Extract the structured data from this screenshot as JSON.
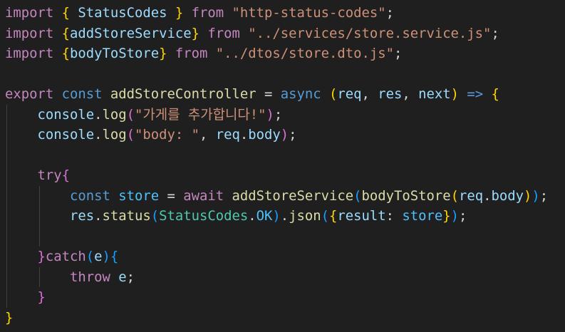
{
  "editor": {
    "theme_colors": {
      "background": "#1f1f1f",
      "keyword_control": "#c586c0",
      "keyword_storage": "#569cd6",
      "function": "#dcdcaa",
      "variable": "#9cdcfe",
      "constant": "#4fc1ff",
      "type": "#4ec9b0",
      "string": "#ce9178",
      "bracket_level1": "#ffd700",
      "bracket_level2": "#da70d6",
      "bracket_level3": "#179fff"
    },
    "lines": [
      [
        {
          "t": "import",
          "c": "kw"
        },
        {
          "t": " ",
          "c": "p"
        },
        {
          "t": "{",
          "c": "b1"
        },
        {
          "t": " StatusCodes ",
          "c": "vr"
        },
        {
          "t": "}",
          "c": "b1"
        },
        {
          "t": " from ",
          "c": "kw"
        },
        {
          "t": "\"http-status-codes\"",
          "c": "s"
        },
        {
          "t": ";",
          "c": "p"
        }
      ],
      [
        {
          "t": "import",
          "c": "kw"
        },
        {
          "t": " ",
          "c": "p"
        },
        {
          "t": "{",
          "c": "b1"
        },
        {
          "t": "addStoreService",
          "c": "vr"
        },
        {
          "t": "}",
          "c": "b1"
        },
        {
          "t": " from ",
          "c": "kw"
        },
        {
          "t": "\"../services/store.service.js\"",
          "c": "s"
        },
        {
          "t": ";",
          "c": "p"
        }
      ],
      [
        {
          "t": "import",
          "c": "kw"
        },
        {
          "t": " ",
          "c": "p"
        },
        {
          "t": "{",
          "c": "b1"
        },
        {
          "t": "bodyToStore",
          "c": "vr"
        },
        {
          "t": "}",
          "c": "b1"
        },
        {
          "t": " from ",
          "c": "kw"
        },
        {
          "t": "\"../dtos/store.dto.js\"",
          "c": "s"
        },
        {
          "t": ";",
          "c": "p"
        }
      ],
      [],
      [
        {
          "t": "export",
          "c": "kw"
        },
        {
          "t": " ",
          "c": "p"
        },
        {
          "t": "const",
          "c": "st"
        },
        {
          "t": " ",
          "c": "p"
        },
        {
          "t": "addStoreController",
          "c": "fn"
        },
        {
          "t": " = ",
          "c": "p"
        },
        {
          "t": "async",
          "c": "st"
        },
        {
          "t": " ",
          "c": "p"
        },
        {
          "t": "(",
          "c": "b1"
        },
        {
          "t": "req",
          "c": "vr"
        },
        {
          "t": ", ",
          "c": "p"
        },
        {
          "t": "res",
          "c": "vr"
        },
        {
          "t": ", ",
          "c": "p"
        },
        {
          "t": "next",
          "c": "vr"
        },
        {
          "t": ")",
          "c": "b1"
        },
        {
          "t": " ",
          "c": "p"
        },
        {
          "t": "=>",
          "c": "st"
        },
        {
          "t": " ",
          "c": "p"
        },
        {
          "t": "{",
          "c": "b1"
        }
      ],
      [
        {
          "t": "    ",
          "c": "p"
        },
        {
          "t": "console",
          "c": "vr"
        },
        {
          "t": ".",
          "c": "p"
        },
        {
          "t": "log",
          "c": "fn"
        },
        {
          "t": "(",
          "c": "b2"
        },
        {
          "t": "\"가게를 추가합니다!\"",
          "c": "s"
        },
        {
          "t": ")",
          "c": "b2"
        },
        {
          "t": ";",
          "c": "p"
        }
      ],
      [
        {
          "t": "    ",
          "c": "p"
        },
        {
          "t": "console",
          "c": "vr"
        },
        {
          "t": ".",
          "c": "p"
        },
        {
          "t": "log",
          "c": "fn"
        },
        {
          "t": "(",
          "c": "b2"
        },
        {
          "t": "\"body: \"",
          "c": "s"
        },
        {
          "t": ", ",
          "c": "p"
        },
        {
          "t": "req",
          "c": "vr"
        },
        {
          "t": ".",
          "c": "p"
        },
        {
          "t": "body",
          "c": "vr"
        },
        {
          "t": ")",
          "c": "b2"
        },
        {
          "t": ";",
          "c": "p"
        }
      ],
      [],
      [
        {
          "t": "    ",
          "c": "p"
        },
        {
          "t": "try",
          "c": "kw"
        },
        {
          "t": "{",
          "c": "b2"
        }
      ],
      [
        {
          "t": "        ",
          "c": "p"
        },
        {
          "t": "const",
          "c": "st"
        },
        {
          "t": " ",
          "c": "p"
        },
        {
          "t": "store",
          "c": "cn"
        },
        {
          "t": " = ",
          "c": "p"
        },
        {
          "t": "await",
          "c": "kw"
        },
        {
          "t": " ",
          "c": "p"
        },
        {
          "t": "addStoreService",
          "c": "fn"
        },
        {
          "t": "(",
          "c": "b3"
        },
        {
          "t": "bodyToStore",
          "c": "fn"
        },
        {
          "t": "(",
          "c": "b1"
        },
        {
          "t": "req",
          "c": "vr"
        },
        {
          "t": ".",
          "c": "p"
        },
        {
          "t": "body",
          "c": "vr"
        },
        {
          "t": ")",
          "c": "b1"
        },
        {
          "t": ")",
          "c": "b3"
        },
        {
          "t": ";",
          "c": "p"
        }
      ],
      [
        {
          "t": "        ",
          "c": "p"
        },
        {
          "t": "res",
          "c": "vr"
        },
        {
          "t": ".",
          "c": "p"
        },
        {
          "t": "status",
          "c": "fn"
        },
        {
          "t": "(",
          "c": "b3"
        },
        {
          "t": "StatusCodes",
          "c": "ty"
        },
        {
          "t": ".",
          "c": "p"
        },
        {
          "t": "OK",
          "c": "cn"
        },
        {
          "t": ")",
          "c": "b3"
        },
        {
          "t": ".",
          "c": "p"
        },
        {
          "t": "json",
          "c": "fn"
        },
        {
          "t": "(",
          "c": "b3"
        },
        {
          "t": "{",
          "c": "b1"
        },
        {
          "t": "result",
          "c": "vr"
        },
        {
          "t": ": ",
          "c": "p"
        },
        {
          "t": "store",
          "c": "cn"
        },
        {
          "t": "}",
          "c": "b1"
        },
        {
          "t": ")",
          "c": "b3"
        },
        {
          "t": ";",
          "c": "p"
        }
      ],
      [],
      [
        {
          "t": "    ",
          "c": "p"
        },
        {
          "t": "}",
          "c": "b2"
        },
        {
          "t": "catch",
          "c": "kw"
        },
        {
          "t": "(",
          "c": "b3"
        },
        {
          "t": "e",
          "c": "vr"
        },
        {
          "t": ")",
          "c": "b3"
        },
        {
          "t": "{",
          "c": "b3"
        }
      ],
      [
        {
          "t": "        ",
          "c": "p"
        },
        {
          "t": "throw",
          "c": "kw"
        },
        {
          "t": " ",
          "c": "p"
        },
        {
          "t": "e",
          "c": "vr"
        },
        {
          "t": ";",
          "c": "p"
        }
      ],
      [
        {
          "t": "    ",
          "c": "p"
        },
        {
          "t": "}",
          "c": "b2"
        }
      ],
      [
        {
          "t": "}",
          "c": "b1"
        }
      ]
    ]
  }
}
